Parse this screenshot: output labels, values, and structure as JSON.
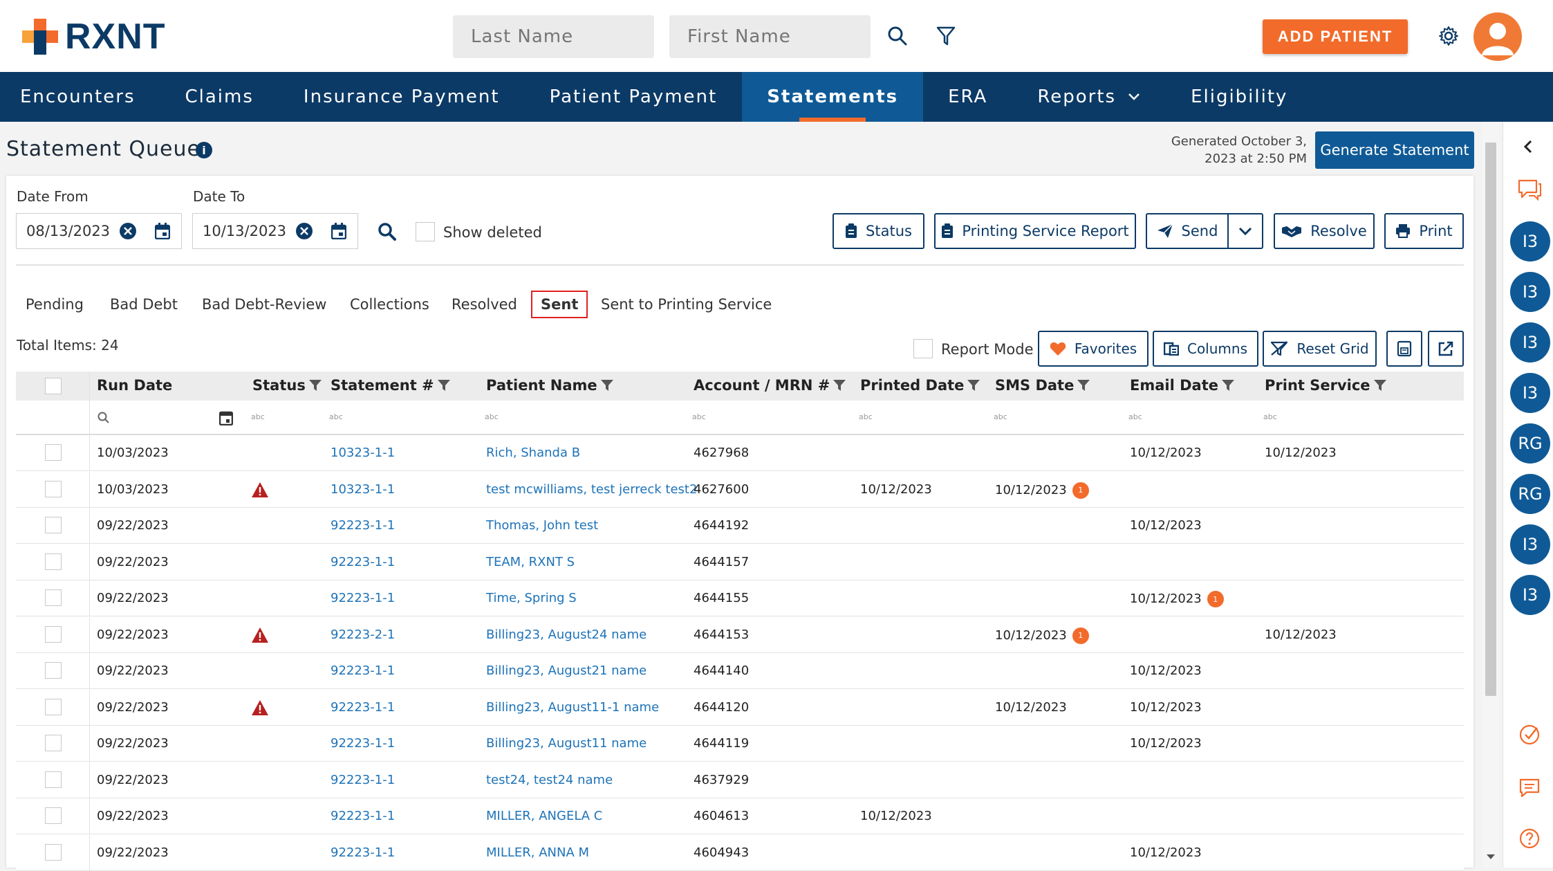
{
  "brand": {
    "name": "RXNT",
    "accent": "#f26b2b",
    "navy": "#0c3a66"
  },
  "header": {
    "last_name_placeholder": "Last Name",
    "first_name_placeholder": "First Name",
    "add_patient_label": "ADD PATIENT"
  },
  "nav": [
    {
      "label": "Encounters"
    },
    {
      "label": "Claims"
    },
    {
      "label": "Insurance Payment"
    },
    {
      "label": "Patient Payment"
    },
    {
      "label": "Statements",
      "active": true
    },
    {
      "label": "ERA"
    },
    {
      "label": "Reports"
    },
    {
      "label": "Eligibility"
    }
  ],
  "page": {
    "title": "Statement Queue",
    "info_icon": "i",
    "generated_line1": "Generated October 3,",
    "generated_line2": "2023 at 2:50 PM",
    "generate_button": "Generate Statement"
  },
  "filters": {
    "date_from_label": "Date From",
    "date_from_value": "08/13/2023",
    "date_to_label": "Date To",
    "date_to_value": "10/13/2023",
    "show_deleted_label": "Show deleted"
  },
  "actions": {
    "status": "Status",
    "printing_report": "Printing Service Report",
    "send": "Send",
    "resolve": "Resolve",
    "print": "Print"
  },
  "tabs": [
    "Pending",
    "Bad Debt",
    "Bad Debt-Review",
    "Collections",
    "Resolved",
    "Sent",
    "Sent to Printing Service"
  ],
  "active_tab": "Sent",
  "grid_toolbar": {
    "total_items": "Total Items: 24",
    "report_mode": "Report Mode",
    "favorites": "Favorites",
    "columns": "Columns",
    "reset_grid": "Reset Grid"
  },
  "columns": [
    "Run Date",
    "Status",
    "Statement #",
    "Patient Name",
    "Account / MRN #",
    "Printed Date",
    "SMS Date",
    "Email Date",
    "Print Service"
  ],
  "filter_placeholder": "abc",
  "rows": [
    {
      "run_date": "10/03/2023",
      "warn": false,
      "statement": "10323-1-1",
      "patient": "Rich, Shanda B",
      "account": "4627968",
      "printed": "",
      "sms": "",
      "sms_badge": "",
      "email": "10/12/2023",
      "email_badge": "",
      "print_service": "10/12/2023"
    },
    {
      "run_date": "10/03/2023",
      "warn": true,
      "statement": "10323-1-1",
      "patient": "test mcwilliams, test jerreck test2",
      "account": "4627600",
      "printed": "10/12/2023",
      "sms": "10/12/2023",
      "sms_badge": "1",
      "email": "",
      "email_badge": "",
      "print_service": ""
    },
    {
      "run_date": "09/22/2023",
      "warn": false,
      "statement": "92223-1-1",
      "patient": "Thomas, John test",
      "account": "4644192",
      "printed": "",
      "sms": "",
      "sms_badge": "",
      "email": "10/12/2023",
      "email_badge": "",
      "print_service": ""
    },
    {
      "run_date": "09/22/2023",
      "warn": false,
      "statement": "92223-1-1",
      "patient": "TEAM, RXNT S",
      "account": "4644157",
      "printed": "",
      "sms": "",
      "sms_badge": "",
      "email": "",
      "email_badge": "",
      "print_service": ""
    },
    {
      "run_date": "09/22/2023",
      "warn": false,
      "statement": "92223-1-1",
      "patient": "Time, Spring S",
      "account": "4644155",
      "printed": "",
      "sms": "",
      "sms_badge": "",
      "email": "10/12/2023",
      "email_badge": "1",
      "print_service": ""
    },
    {
      "run_date": "09/22/2023",
      "warn": true,
      "statement": "92223-2-1",
      "patient": "Billing23, August24 name",
      "account": "4644153",
      "printed": "",
      "sms": "10/12/2023",
      "sms_badge": "1",
      "email": "",
      "email_badge": "",
      "print_service": "10/12/2023"
    },
    {
      "run_date": "09/22/2023",
      "warn": false,
      "statement": "92223-1-1",
      "patient": "Billing23, August21 name",
      "account": "4644140",
      "printed": "",
      "sms": "",
      "sms_badge": "",
      "email": "10/12/2023",
      "email_badge": "",
      "print_service": ""
    },
    {
      "run_date": "09/22/2023",
      "warn": true,
      "statement": "92223-1-1",
      "patient": "Billing23, August11-1 name",
      "account": "4644120",
      "printed": "",
      "sms": "10/12/2023",
      "sms_badge": "",
      "email": "10/12/2023",
      "email_badge": "",
      "print_service": ""
    },
    {
      "run_date": "09/22/2023",
      "warn": false,
      "statement": "92223-1-1",
      "patient": "Billing23, August11 name",
      "account": "4644119",
      "printed": "",
      "sms": "",
      "sms_badge": "",
      "email": "10/12/2023",
      "email_badge": "",
      "print_service": ""
    },
    {
      "run_date": "09/22/2023",
      "warn": false,
      "statement": "92223-1-1",
      "patient": "test24, test24 name",
      "account": "4637929",
      "printed": "",
      "sms": "",
      "sms_badge": "",
      "email": "",
      "email_badge": "",
      "print_service": ""
    },
    {
      "run_date": "09/22/2023",
      "warn": false,
      "statement": "92223-1-1",
      "patient": "MILLER, ANGELA C",
      "account": "4604613",
      "printed": "10/12/2023",
      "sms": "",
      "sms_badge": "",
      "email": "",
      "email_badge": "",
      "print_service": ""
    },
    {
      "run_date": "09/22/2023",
      "warn": false,
      "statement": "92223-1-1",
      "patient": "MILLER, ANNA M",
      "account": "4604943",
      "printed": "",
      "sms": "",
      "sms_badge": "",
      "email": "10/12/2023",
      "email_badge": "",
      "print_service": ""
    }
  ],
  "right_rail": {
    "avatars": [
      "I3",
      "I3",
      "I3",
      "I3",
      "RG",
      "RG",
      "I3",
      "I3"
    ]
  }
}
